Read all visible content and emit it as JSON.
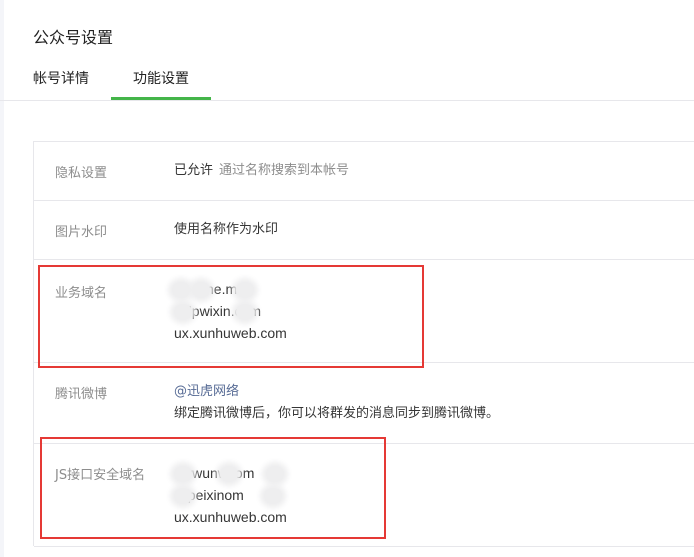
{
  "page": {
    "title": "公众号设置"
  },
  "tabs": [
    {
      "label": "帐号详情",
      "active": false
    },
    {
      "label": "功能设置",
      "active": true
    }
  ],
  "settings": {
    "privacy": {
      "label": "隐私设置",
      "value": "已允许",
      "note": "通过名称搜索到本帐号"
    },
    "watermark": {
      "label": "图片水印",
      "value": "使用名称作为水印"
    },
    "business_domain": {
      "label": "业务域名",
      "domains": [
        "ne.m",
        "dpwixin.com",
        "ux.xunhuweb.com"
      ]
    },
    "weibo": {
      "label": "腾讯微博",
      "link": "@迅虎网络",
      "desc": "绑定腾讯微博后，你可以将群发的消息同步到腾讯微博。"
    },
    "js_domain": {
      "label": "JS接口安全域名",
      "domains": [
        "wwunwcom",
        "dpeixinom",
        "ux.xunhuweb.com"
      ]
    }
  },
  "colors": {
    "accent": "#44b549",
    "highlight": "#e53935",
    "link": "#576b95"
  }
}
